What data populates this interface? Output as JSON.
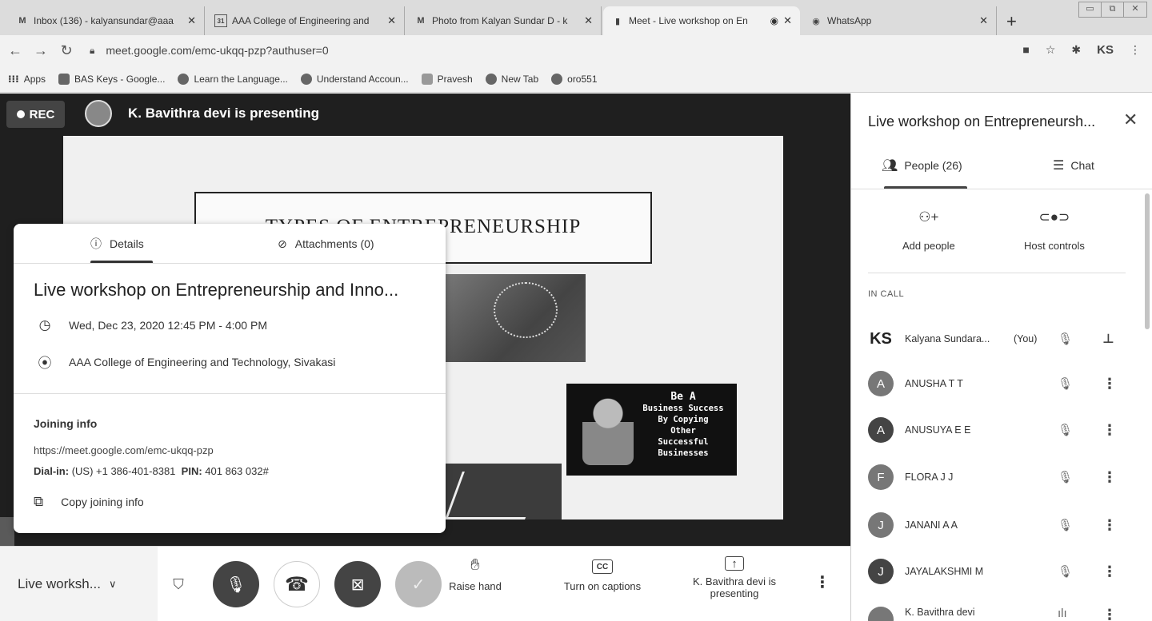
{
  "browser": {
    "tabs": [
      {
        "icon": "M",
        "title": "Inbox (136) - kalyansundar@aaa",
        "active": false
      },
      {
        "icon": "31",
        "title": "AAA College of Engineering and",
        "active": false
      },
      {
        "icon": "M",
        "title": "Photo from Kalyan Sundar D - k",
        "active": false
      },
      {
        "icon": "▮",
        "title": "Meet - Live workshop on En",
        "active": true
      },
      {
        "icon": "◉",
        "title": "WhatsApp",
        "active": false
      }
    ],
    "new_tab": "+",
    "url": "meet.google.com/emc-ukqq-pzp?authuser=0",
    "profile": "KS",
    "bookmarks": [
      "Apps",
      "BAS Keys - Google...",
      "Learn the Language...",
      "Understand Accoun...",
      "Pravesh",
      "New Tab",
      "oro551"
    ]
  },
  "stage": {
    "rec_label": "REC",
    "presenting_text": "K. Bavithra devi is presenting",
    "slide": {
      "title": "TYPES OF ENTREPRENEURSHIP",
      "success_line1": "Be A",
      "success_rest": "Business Success\nBy Copying\nOther\nSuccessful\nBusinesses"
    }
  },
  "details": {
    "tab_details": "Details",
    "tab_attachments": "Attachments (0)",
    "title": "Live workshop on Entrepreneurship and Inno...",
    "datetime": "Wed, Dec 23, 2020 12:45 PM - 4:00 PM",
    "location": "AAA College of Engineering and Technology, Sivakasi",
    "joining_heading": "Joining info",
    "joining_url": "https://meet.google.com/emc-ukqq-pzp",
    "dialin_label": "Dial-in:",
    "dialin_number": "(US) +1 386-401-8381",
    "pin_label": "PIN:",
    "pin_value": "401 863 032#",
    "copy_label": "Copy joining info"
  },
  "controls": {
    "meeting_short": "Live worksh...",
    "raise_hand": "Raise hand",
    "captions": "Turn on captions",
    "captions_icon": "CC",
    "present_line": "K. Bavithra devi is presenting"
  },
  "panel": {
    "title": "Live workshop on Entrepreneursh...",
    "people_tab": "People (26)",
    "chat_tab": "Chat",
    "add_people": "Add people",
    "host_controls": "Host controls",
    "in_call": "IN CALL",
    "participants": [
      {
        "initial": "KS",
        "name": "Kalyana Sundara...",
        "you": "(You)"
      },
      {
        "initial": "A",
        "name": "ANUSHA T T"
      },
      {
        "initial": "A",
        "name": "ANUSUYA E E"
      },
      {
        "initial": "F",
        "name": "FLORA J J"
      },
      {
        "initial": "J",
        "name": "JANANI A A"
      },
      {
        "initial": "J",
        "name": "JAYALAKSHMI M"
      },
      {
        "initial": "",
        "name": "K. Bavithra devi"
      }
    ]
  }
}
